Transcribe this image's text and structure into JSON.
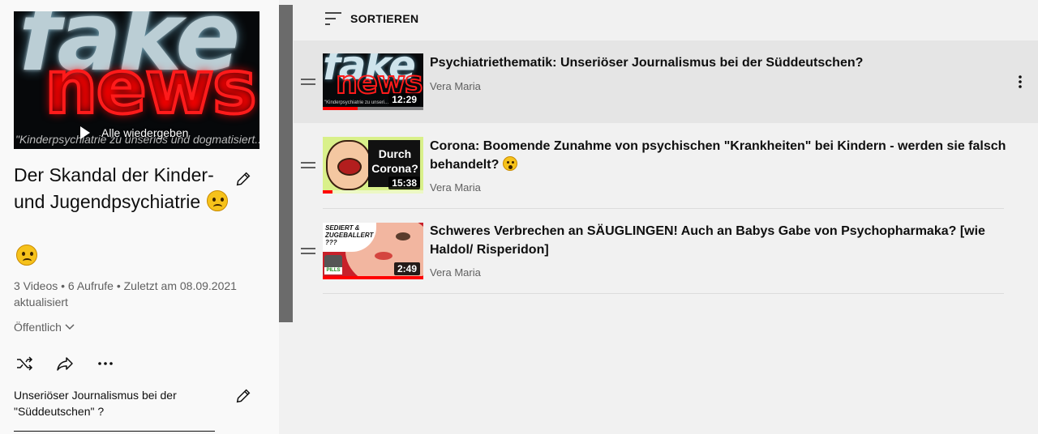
{
  "playlist": {
    "title": "Der Skandal der Kinder- und Jugendpsychiatrie",
    "title_emoji": "sad-face-emoji",
    "thumbnail_text_fake": "fake",
    "thumbnail_text_news": "news",
    "thumbnail_subtitle": "\"Kinderpsychiatrie zu unseriös und dogmatisiert...\"",
    "play_all_label": "Alle wiedergeben",
    "meta": "3 Videos • 6 Aufrufe • Zuletzt am 08.09.2021 aktualisiert",
    "privacy": "Öffentlich",
    "description": "Unseriöser Journalismus bei der \"Süddeutschen\" ?",
    "icons": [
      "pencil-icon",
      "shuffle-icon",
      "share-icon",
      "more-horizontal-icon",
      "chevron-down-icon"
    ]
  },
  "sort": {
    "label": "SORTIEREN",
    "icon": "sort-icon"
  },
  "videos": [
    {
      "title": "Psychiatriethematik: Unseriöser Journalismus bei der Süddeutschen?",
      "channel": "Vera Maria",
      "duration": "12:29",
      "thumb_fake": "fake",
      "thumb_news": "news",
      "thumb_sub": "\"Kinderpsychiatrie zu unseri...",
      "watched_fraction": 0.35
    },
    {
      "title": "Corona: Boomende Zunahme von psychischen \"Krankheiten\" bei Kindern - werden sie falsch behandelt?",
      "channel": "Vera Maria",
      "duration": "15:38",
      "thumb_text": "Durch Corona?",
      "watched_fraction": 0.1
    },
    {
      "title": "Schweres Verbrechen an SÄUGLINGEN! Auch an Babys Gabe von Psychopharmaka? [wie Haldol/ Risperidon]",
      "channel": "Vera Maria",
      "duration": "2:49",
      "thumb_text": "SEDIERT & ZUGEBALLERT ???",
      "thumb_pills": "PILLS",
      "watched_fraction": 1.0
    }
  ]
}
